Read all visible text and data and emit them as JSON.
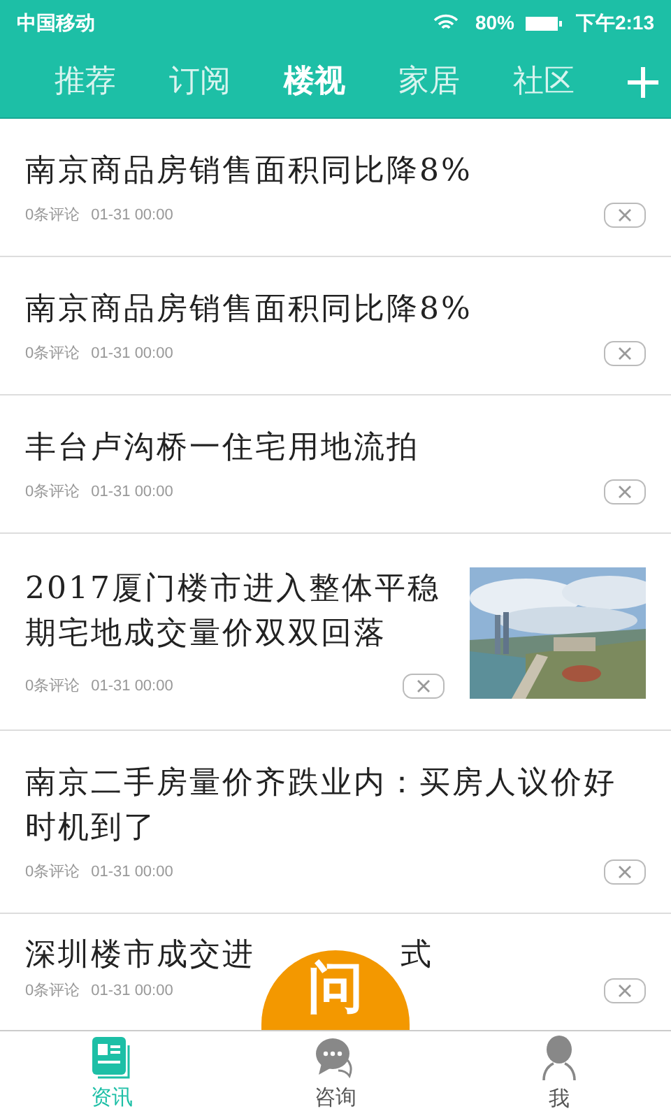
{
  "status_bar": {
    "carrier": "中国移动",
    "battery": "80%",
    "time": "下午2:13"
  },
  "tabs": [
    {
      "label": "推荐",
      "selected": false
    },
    {
      "label": "订阅",
      "selected": false
    },
    {
      "label": "楼视",
      "selected": true
    },
    {
      "label": "家居",
      "selected": false
    },
    {
      "label": "社区",
      "selected": false
    }
  ],
  "articles": [
    {
      "kind": "text",
      "title": "南京商品房销售面积同比降8%",
      "comments": "0条评论",
      "time": "01-31 00:00"
    },
    {
      "kind": "text",
      "title": "南京商品房销售面积同比降8%",
      "comments": "0条评论",
      "time": "01-31 00:00"
    },
    {
      "kind": "text",
      "title": "丰台卢沟桥一住宅用地流拍",
      "comments": "0条评论",
      "time": "01-31 00:00"
    },
    {
      "title": "2017厦门楼市进入整体平稳期宅地成交量价双双回落",
      "comments": "0条评论",
      "time": "01-31 00:00"
    },
    {
      "kind": "text",
      "title": "南京二手房量价齐跌业内：买房人议价好时机到了",
      "comments": "0条评论",
      "time": "01-31 00:00"
    },
    {
      "kind": "covered",
      "title": "深圳楼市成交进",
      "title_end": "式",
      "comments": "0条评论",
      "time": "01-31 00:00"
    }
  ],
  "ask_button": "问",
  "bottom_nav": [
    {
      "label": "资讯",
      "kind": "news",
      "selected": true
    },
    {
      "label": "咨询",
      "kind": "chat",
      "selected": false
    },
    {
      "label": "我",
      "kind": "person",
      "selected": false
    }
  ]
}
